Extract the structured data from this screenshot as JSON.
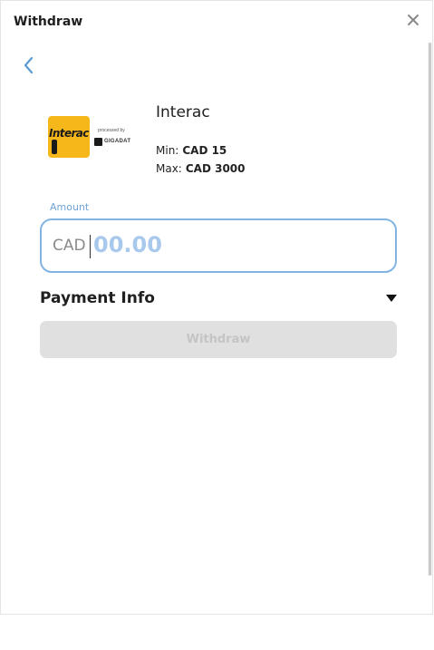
{
  "header": {
    "title": "Withdraw",
    "close_icon": "close-icon"
  },
  "back_icon": "chevron-left-icon",
  "payment_method": {
    "logo_text": "Interac",
    "processed_by": "processed by",
    "processor": "GIGADAT",
    "name": "Interac",
    "min_label": "Min:",
    "min_value": "CAD 15",
    "max_label": "Max:",
    "max_value": "CAD 3000"
  },
  "amount": {
    "label": "Amount",
    "currency": "CAD",
    "value": "00.00"
  },
  "payment_info": {
    "label": "Payment Info",
    "icon": "caret-down-icon"
  },
  "withdraw_button": {
    "label": "Withdraw",
    "enabled": false
  },
  "colors": {
    "accent": "#82b4e2",
    "amount_label": "#6fa3d6",
    "amount_value": "#a9c9ec",
    "interac_yellow": "#f6b71b",
    "button_disabled_bg": "#e0e0e0",
    "button_disabled_text": "#c4c4c4"
  }
}
